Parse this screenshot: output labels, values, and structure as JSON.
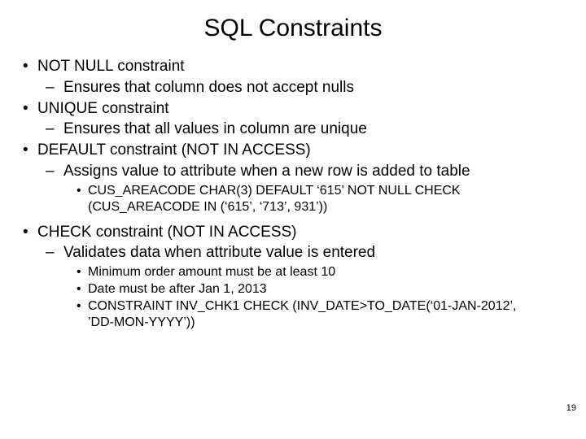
{
  "title": "SQL Constraints",
  "bullets": {
    "b1": "NOT NULL constraint",
    "b1_1": "Ensures that column does not accept nulls",
    "b2": "UNIQUE constraint",
    "b2_1": "Ensures that all values in column are unique",
    "b3": "DEFAULT constraint (NOT IN ACCESS)",
    "b3_1": "Assigns value to attribute when a new row is added to table",
    "b3_1_1": "CUS_AREACODE CHAR(3) DEFAULT ‘615’ NOT NULL CHECK (CUS_AREACODE IN (‘615’, ‘713’, 931’))",
    "b4": "CHECK constraint (NOT IN ACCESS)",
    "b4_1": "Validates data when attribute value is entered",
    "b4_1_1": "Minimum order amount must be at least 10",
    "b4_1_2": "Date must be after Jan 1, 2013",
    "b4_1_3": "CONSTRAINT INV_CHK1 CHECK (INV_DATE>TO_DATE(‘01-JAN-2012’, ’DD-MON-YYYY’))"
  },
  "markers": {
    "dot": "•",
    "dash": "–"
  },
  "page_number": "19"
}
